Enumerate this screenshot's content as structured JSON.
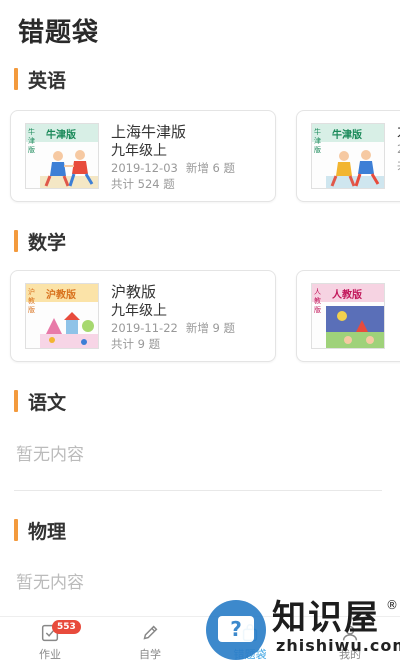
{
  "page": {
    "title": "错题袋"
  },
  "sections": [
    {
      "title": "英语",
      "books": [
        {
          "brand": "牛津版",
          "side": "牛津版",
          "edition": "上海牛津版",
          "grade": "九年级上",
          "date": "2019-12-03",
          "added": "新增 6 题",
          "total": "共计 524 题"
        },
        {
          "brand": "牛津版",
          "side": "牛津版",
          "edition": "",
          "grade": "九",
          "date": "2",
          "added": "",
          "total": "共"
        }
      ]
    },
    {
      "title": "数学",
      "books": [
        {
          "brand": "沪教版",
          "side": "沪教版",
          "edition": "沪教版",
          "grade": "九年级上",
          "date": "2019-11-22",
          "added": "新增 9 题",
          "total": "共计 9 题"
        },
        {
          "brand": "人教版",
          "side": "人教版",
          "edition": "",
          "grade": "",
          "date": "",
          "added": "",
          "total": ""
        }
      ]
    },
    {
      "title": "语文",
      "empty": "暂无内容"
    },
    {
      "title": "物理",
      "empty": "暂无内容"
    }
  ],
  "bottom_nav": {
    "tabs": [
      {
        "label": "作业",
        "icon": "homework-icon",
        "badge": "553"
      },
      {
        "label": "自学",
        "icon": "pencil-icon"
      },
      {
        "label": "错题袋",
        "icon": "bag-icon",
        "active": true
      },
      {
        "label": "我的",
        "icon": "profile-icon"
      }
    ]
  },
  "watermark": {
    "title": "知识屋",
    "reg": "®",
    "domain": "zhishiwu.com",
    "q": "?"
  },
  "colors": {
    "accent_bar": "#f39a3d",
    "badge": "#e84b3c",
    "active_tab": "#3aa3e3",
    "watermark_blue": "#2d7fc8"
  }
}
